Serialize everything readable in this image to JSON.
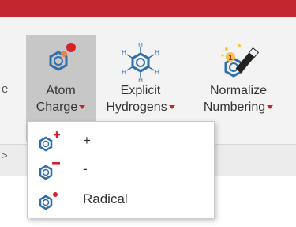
{
  "ribbon": {
    "left_edge_text": "e",
    "lower_edge_text": ">",
    "buttons": [
      {
        "line1": "Atom",
        "line2": "Charge",
        "icon": "atom-charge-icon"
      },
      {
        "line1": "Explicit",
        "line2": "Hydrogens",
        "icon": "explicit-hydrogens-icon"
      },
      {
        "line1": "Normalize",
        "line2": "Numbering",
        "icon": "normalize-numbering-icon"
      }
    ]
  },
  "dropdown": {
    "items": [
      {
        "label": "+",
        "icon": "positive-charge-icon"
      },
      {
        "label": "-",
        "icon": "negative-charge-icon"
      },
      {
        "label": "Radical",
        "icon": "radical-icon"
      }
    ]
  },
  "colors": {
    "accent": "#c4262e",
    "icon_blue": "#2f6fae",
    "selected_bg": "#c7c7c7"
  }
}
